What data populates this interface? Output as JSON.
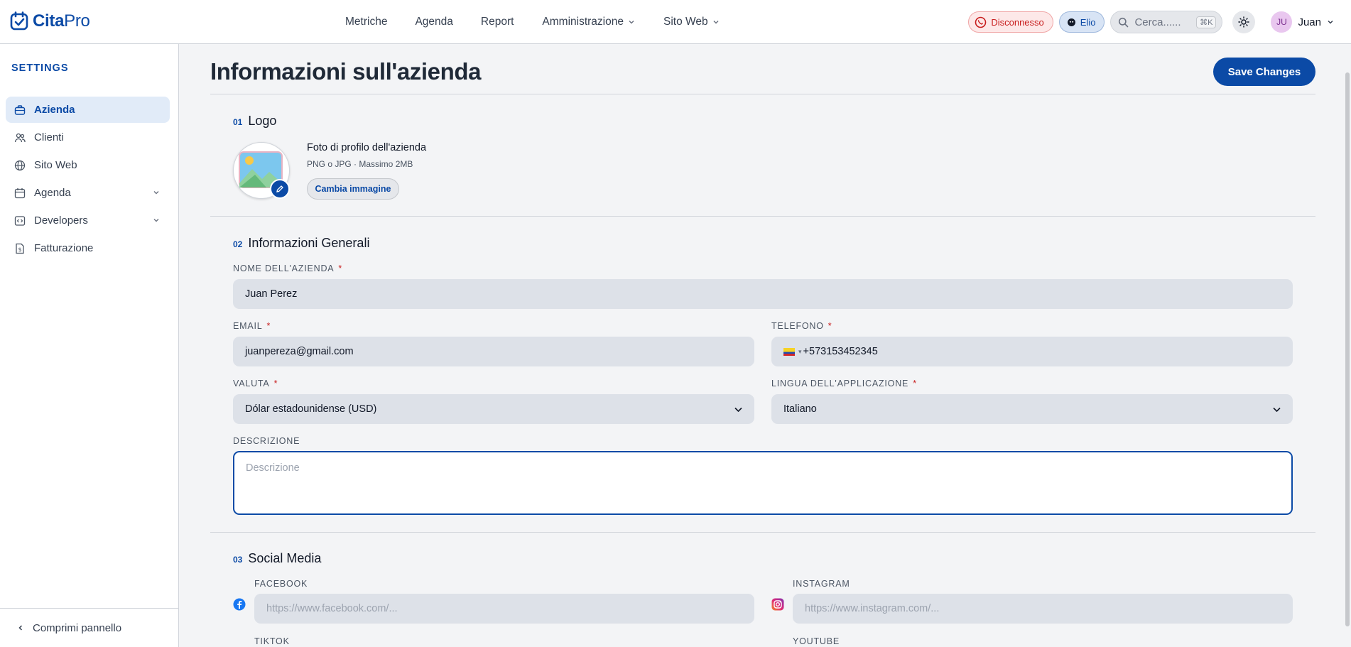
{
  "app": {
    "logo_text_a": "Cita",
    "logo_text_b": "Pro"
  },
  "nav": {
    "items": [
      {
        "label": "Metriche"
      },
      {
        "label": "Agenda"
      },
      {
        "label": "Report"
      },
      {
        "label": "Amministrazione"
      },
      {
        "label": "Sito Web"
      }
    ]
  },
  "topbar": {
    "whatsapp_status": "Disconnesso",
    "assistant_label": "Elio",
    "search_placeholder": "Cerca......",
    "search_shortcut": "⌘K",
    "user_initials": "JU",
    "user_name": "Juan"
  },
  "sidebar": {
    "title": "SETTINGS",
    "items": [
      {
        "label": "Azienda",
        "icon": "briefcase-icon",
        "active": true
      },
      {
        "label": "Clienti",
        "icon": "users-icon"
      },
      {
        "label": "Sito Web",
        "icon": "globe-icon"
      },
      {
        "label": "Agenda",
        "icon": "calendar-icon",
        "expandable": true
      },
      {
        "label": "Developers",
        "icon": "code-icon",
        "expandable": true
      },
      {
        "label": "Fatturazione",
        "icon": "invoice-icon"
      }
    ],
    "collapse_label": "Comprimi pannello"
  },
  "page": {
    "title": "Informazioni sull'azienda",
    "save_label": "Save Changes"
  },
  "logo_section": {
    "num": "01",
    "title": "Logo",
    "photo_title": "Foto di profilo dell'azienda",
    "photo_hint": "PNG o JPG · Massimo 2MB",
    "change_label": "Cambia immagine"
  },
  "general_section": {
    "num": "02",
    "title": "Informazioni Generali",
    "company_name_label": "NOME DELL'AZIENDA",
    "company_name_value": "Juan Perez",
    "email_label": "EMAIL",
    "email_value": "juanpereza@gmail.com",
    "phone_label": "TELEFONO",
    "phone_value": "+573153452345",
    "currency_label": "VALUTA",
    "currency_value": "Dólar estadounidense (USD)",
    "language_label": "LINGUA DELL'APPLICAZIONE",
    "language_value": "Italiano",
    "description_label": "DESCRIZIONE",
    "description_placeholder": "Descrizione",
    "required_mark": "*"
  },
  "social_section": {
    "num": "03",
    "title": "Social Media",
    "facebook_label": "FACEBOOK",
    "facebook_placeholder": "https://www.facebook.com/...",
    "instagram_label": "INSTAGRAM",
    "instagram_placeholder": "https://www.instagram.com/...",
    "tiktok_label": "TIKTOK",
    "youtube_label": "YOUTUBE"
  },
  "colors": {
    "primary": "#0b4aa6",
    "danger": "#c81e1e",
    "field_bg": "#dde1e8"
  }
}
